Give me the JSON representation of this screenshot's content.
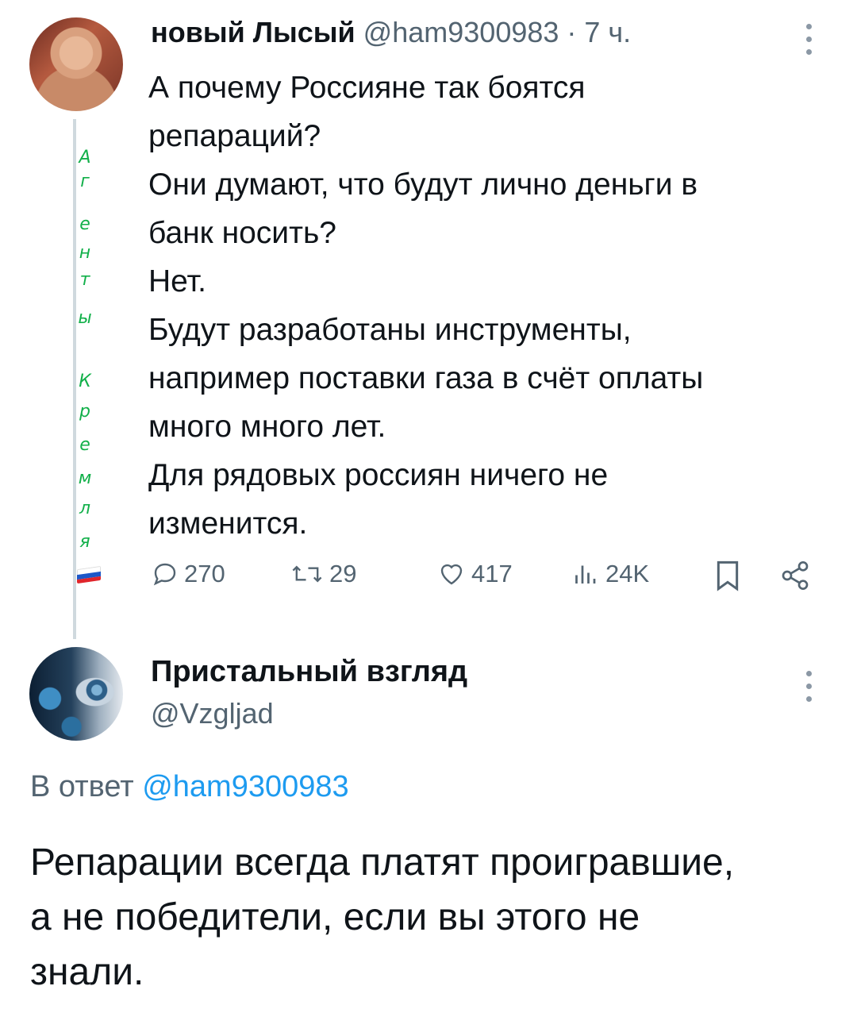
{
  "tweet1": {
    "author_name": "новый Лысый",
    "handle": "@ham9300983",
    "time": " · 7 ч.",
    "lines": [
      "А почему Россияне так боятся",
      "репараций?",
      "Они думают, что будут лично деньги в",
      "банк носить?",
      "Нет.",
      "Будут разработаны инструменты,",
      "например поставки газа в счёт оплаты",
      "много много лет.",
      "Для рядовых россиян ничего не",
      "изменится."
    ],
    "label_letters": [
      "А",
      "г",
      "е",
      "н",
      "т",
      "ы",
      "К",
      "р",
      "е",
      "м",
      "л",
      "я"
    ],
    "actions": {
      "replies": "270",
      "retweets": "29",
      "likes": "417",
      "views": "24K"
    }
  },
  "tweet2": {
    "author_name": "Пристальный взгляд",
    "handle": "@Vzgljad",
    "reply_prefix": "В ответ ",
    "reply_mention": "@ham9300983",
    "lines": [
      "Репарации всегда платят проигравшие,",
      "а не победители, если вы этого не",
      "знали."
    ]
  },
  "colors": {
    "label_green": "#12b04a",
    "secondary": "#536471",
    "link": "#1d9bf0"
  },
  "icons": [
    "more-icon",
    "reply-icon",
    "retweet-icon",
    "like-icon",
    "views-icon",
    "bookmark-icon",
    "share-icon",
    "russian-flag-icon"
  ]
}
